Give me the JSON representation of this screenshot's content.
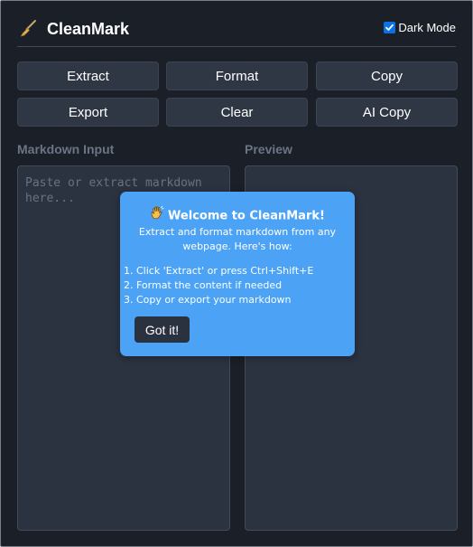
{
  "header": {
    "app_name": "CleanMark",
    "logo_icon": "broom-icon",
    "dark_mode": {
      "label": "Dark Mode",
      "checked": true
    }
  },
  "toolbar": {
    "extract_label": "Extract",
    "format_label": "Format",
    "copy_label": "Copy",
    "export_label": "Export",
    "clear_label": "Clear",
    "ai_copy_label": "AI Copy"
  },
  "panels": {
    "input_label": "Markdown Input",
    "input_placeholder": "Paste or extract markdown here...",
    "input_value": "",
    "preview_label": "Preview"
  },
  "welcome_dialog": {
    "icon": "waving-hand-icon",
    "title": "Welcome to CleanMark!",
    "subtitle": "Extract and format markdown from any webpage. Here's how:",
    "steps": [
      "1. Click 'Extract' or press Ctrl+Shift+E",
      "2. Format the content if needed",
      "3. Copy or export your markdown"
    ],
    "button_label": "Got it!"
  },
  "colors": {
    "background": "#1b1f27",
    "button": "#2f3644",
    "panel": "#2b3240",
    "dialog": "#4ca3f6",
    "accent_checkbox": "#0a72e6"
  }
}
